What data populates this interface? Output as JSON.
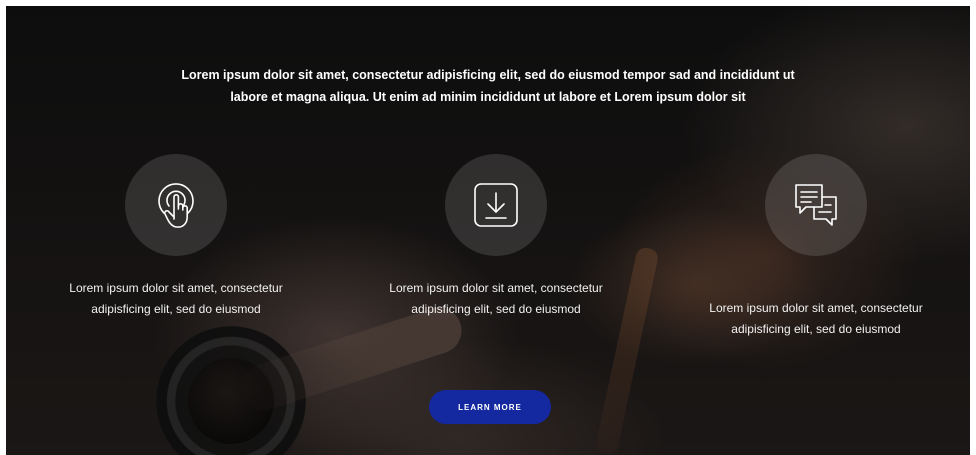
{
  "intro": {
    "line1": "Lorem ipsum dolor sit amet, consectetur adipisficing elit, sed do eiusmod tempor sad and incididunt ut",
    "line2": "labore et magna aliqua. Ut enim ad minim incididunt ut labore et Lorem ipsum dolor sit"
  },
  "features": [
    {
      "icon": "touch-icon",
      "line1": "Lorem ipsum dolor sit amet, consectetur",
      "line2": "adipisficing elit, sed do eiusmod"
    },
    {
      "icon": "download-icon",
      "line1": "Lorem ipsum dolor sit amet, consectetur",
      "line2": "adipisficing elit, sed do eiusmod"
    },
    {
      "icon": "chat-icon",
      "line1": "Lorem ipsum dolor sit amet, consectetur",
      "line2": "adipisficing elit, sed do eiusmod"
    }
  ],
  "cta": {
    "label": "LEARN MORE"
  },
  "colors": {
    "button": "#1428a0",
    "text": "#ffffff"
  }
}
